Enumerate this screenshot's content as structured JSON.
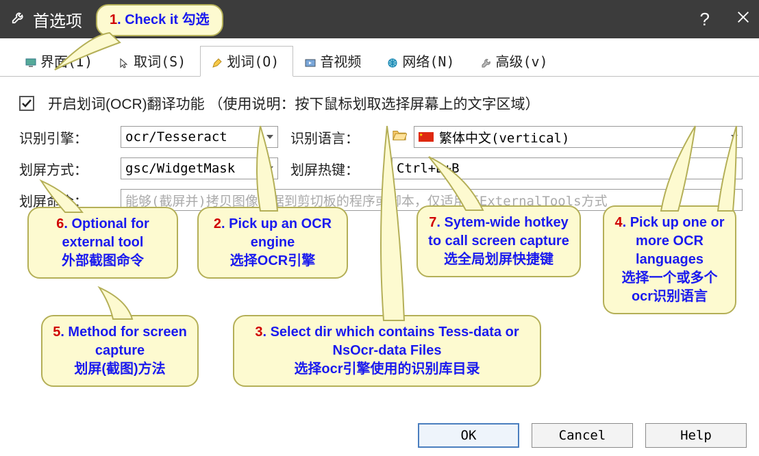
{
  "window": {
    "title": "首选项",
    "help_glyph": "?",
    "close_label": "Close"
  },
  "tabs": [
    {
      "label": "界面(I)",
      "active": false
    },
    {
      "label": "取词(S)",
      "active": false
    },
    {
      "label": "划词(O)",
      "active": true
    },
    {
      "label": "音视频",
      "active": false
    },
    {
      "label": "网络(N)",
      "active": false
    },
    {
      "label": "高级(v)",
      "active": false
    }
  ],
  "enable": {
    "checked": true,
    "label": "开启划词(OCR)翻译功能 （使用说明：按下鼠标划取选择屏幕上的文字区域）"
  },
  "fields": {
    "engine_label": "识别引擎：",
    "engine_value": "ocr/Tesseract",
    "lang_label": "识别语言：",
    "lang_value": "繁体中文(vertical)",
    "method_label": "划屏方式：",
    "method_value": "gsc/WidgetMask",
    "hotkey_label": "划屏热键：",
    "hotkey_value": "Ctrl+B+B",
    "cmd_label": "划屏命令：",
    "cmd_placeholder": "能够(截屏并)拷贝图像数据到剪切板的程序或脚本，仅适用于ExternalTools方式"
  },
  "buttons": {
    "ok": "OK",
    "cancel": "Cancel",
    "help": "Help"
  },
  "callouts": {
    "c1": {
      "num": "1",
      "en": ". Check it ",
      "cn": "勾选"
    },
    "c2": {
      "num": "2",
      "en": ". Pick up an OCR engine",
      "cn": "选择OCR引擎"
    },
    "c3": {
      "num": "3",
      "en": ". Select dir which contains Tess-data or NsOcr-data Files",
      "cn": "选择ocr引擎使用的识别库目录"
    },
    "c4": {
      "num": "4",
      "en": ". Pick up one or more OCR languages",
      "cn": "选择一个或多个ocr识别语言"
    },
    "c5": {
      "num": "5",
      "en": ". Method for screen capture",
      "cn": "划屏(截图)方法"
    },
    "c6": {
      "num": "6",
      "en": ". Optional for external tool",
      "cn": "外部截图命令"
    },
    "c7": {
      "num": "7",
      "en": ". Sytem-wide hotkey to call screen capture",
      "cn": "选全局划屏快捷键"
    }
  }
}
